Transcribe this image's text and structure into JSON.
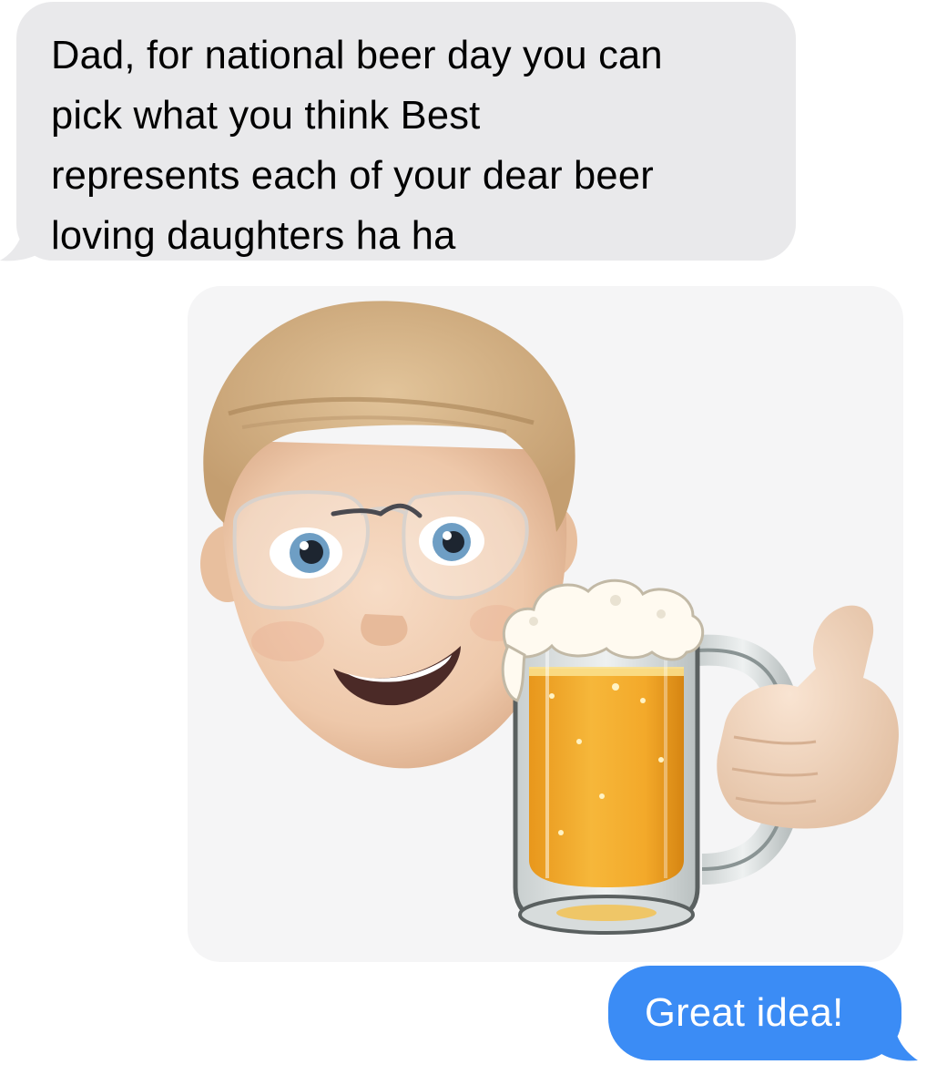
{
  "conversation": {
    "incoming_message": {
      "text": "Dad, for national beer day you can\npick what you think Best\nrepresents each of your dear beer\nloving daughters ha ha",
      "bubble_color": "#e9e9eb"
    },
    "sticker": {
      "icon": "memoji-beer-thumbs-up-sticker",
      "background_color": "#f5f5f6"
    },
    "outgoing_message": {
      "text": "Great idea!",
      "bubble_color": "#3b8cf5"
    }
  }
}
